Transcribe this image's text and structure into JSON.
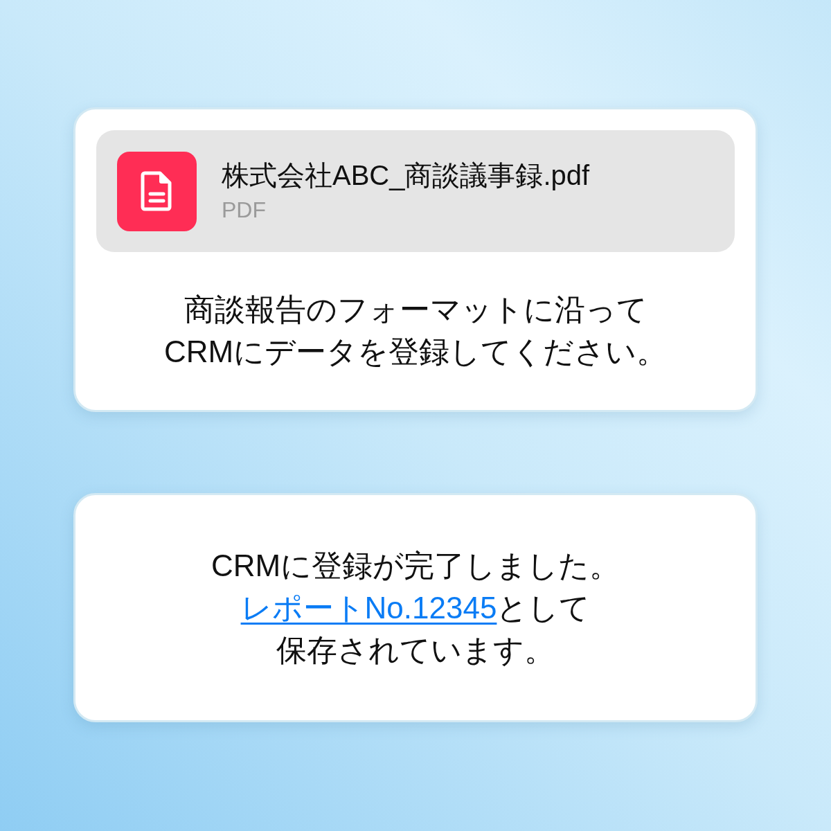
{
  "request_card": {
    "attachment": {
      "file_name": "株式会社ABC_商談議事録.pdf",
      "file_type": "PDF"
    },
    "message_lines": [
      "商談報告のフォーマットに沿って",
      "CRMにデータを登録してください。"
    ]
  },
  "reply_card": {
    "line_1": "CRMに登録が完了しました。",
    "link": "レポートNo.12345",
    "line_2_rest": "として",
    "line_3": "保存されています。"
  }
}
